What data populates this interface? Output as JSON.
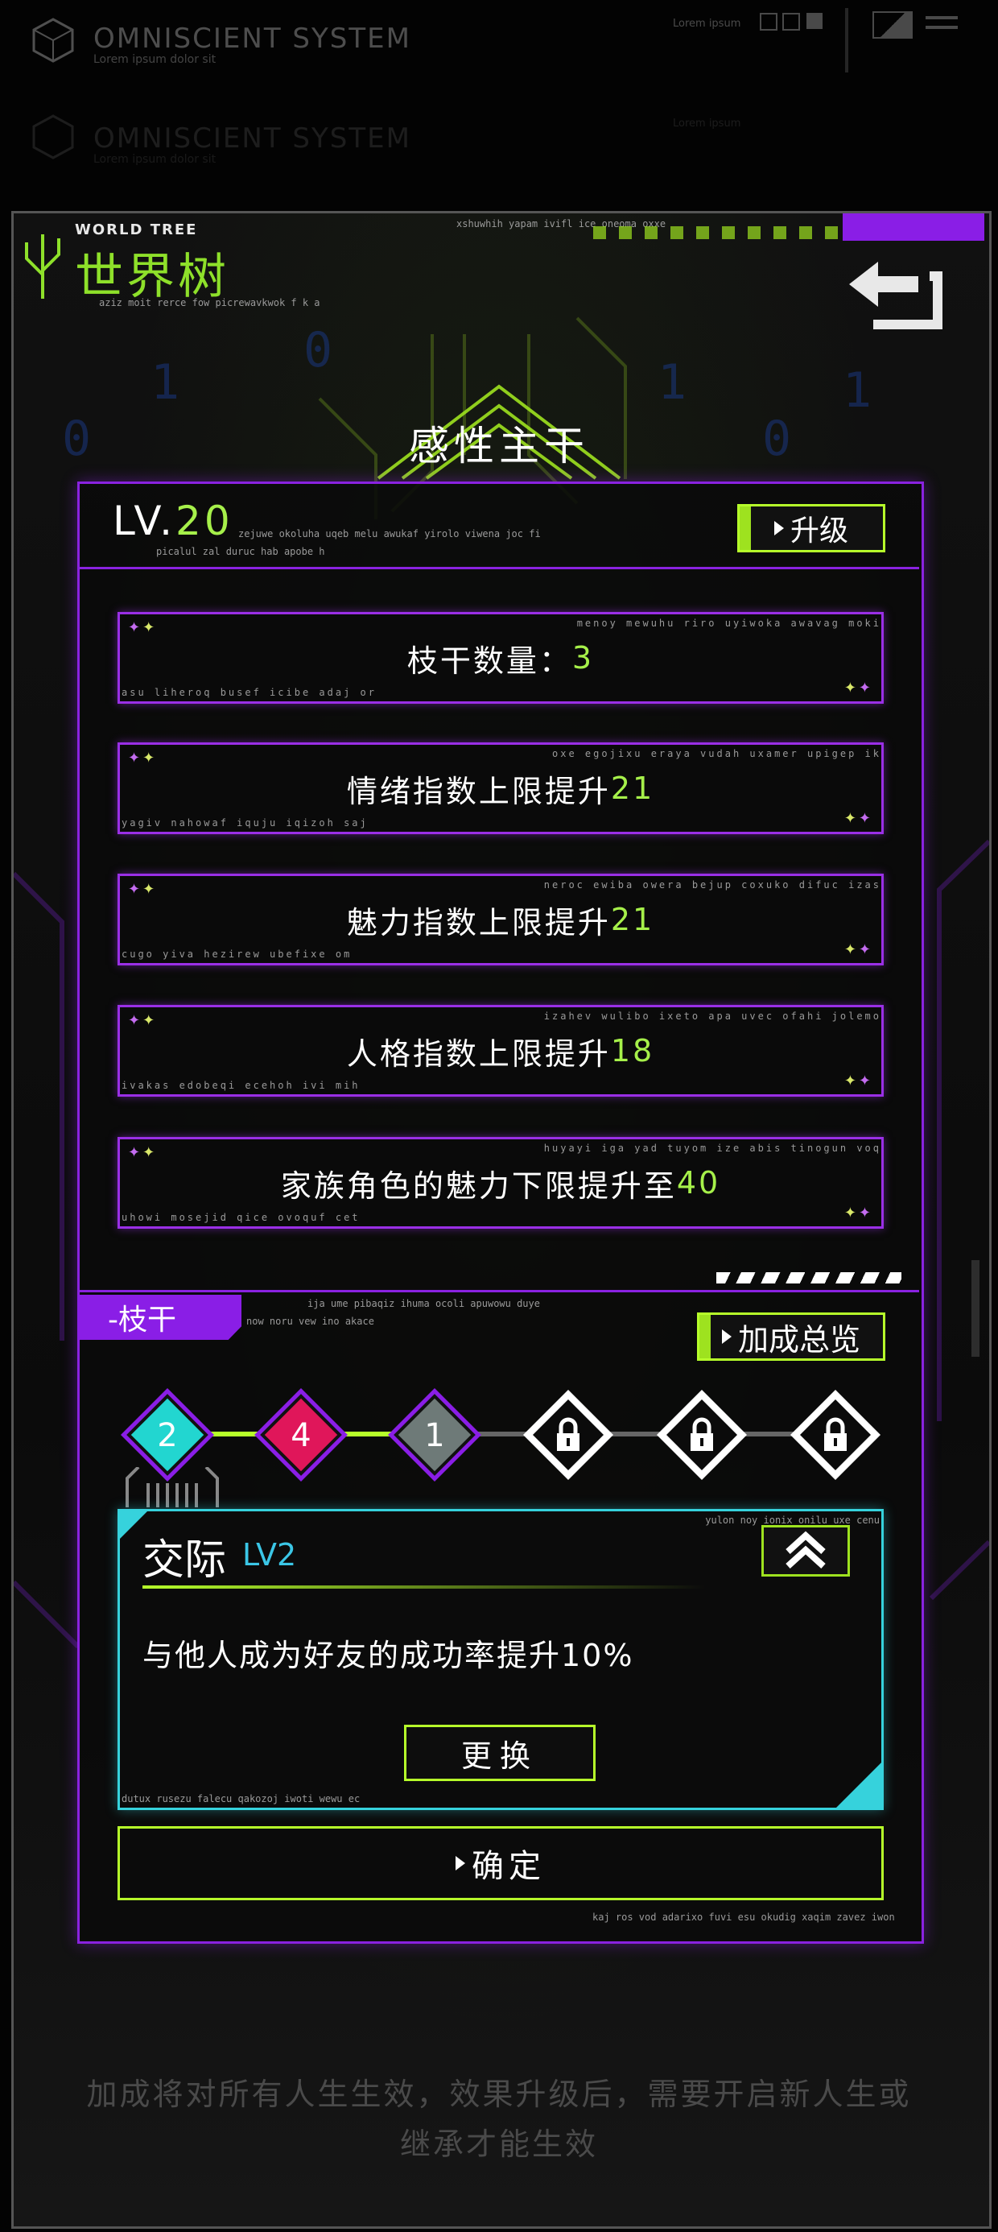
{
  "top_header": {
    "brand": "OMNISCIENT SYSTEM",
    "brand_sub": "Lorem ipsum dolor sit",
    "right_label": "Lorem ipsum",
    "brand_ghost": "OMNISCIENT SYSTEM",
    "brand_sub_ghost": "Lorem ipsum dolor sit",
    "right_label_ghost": "Lorem ipsum"
  },
  "header": {
    "en_title": "WORLD TREE",
    "cn_title": "世界树",
    "deco_top": "xshuwhih yapam ivifl ice oneoma oxxe",
    "deco_sub": "aziz moit rerce fow picrewavkwok f k a",
    "back_icon": "back-arrow-icon"
  },
  "main_title": "感性主干",
  "level": {
    "prefix": "LV.",
    "value": "20",
    "deco1": "zejuwe okoluha uqeb melu awukaf yirolo viwena joc fi",
    "deco2": "picalul zal duruc hab apobe h",
    "upgrade_label": "升级"
  },
  "stats": [
    {
      "label": "枝干数量：",
      "value": "3",
      "deco_tr": "menoy mewuhu riro uyiwoka awavag moki",
      "deco_bl": "asu liheroq busef icibe adaj or"
    },
    {
      "label": "情绪指数上限提升",
      "value": "21",
      "deco_tr": "oxe egojixu eraya vudah uxamer upigep ik",
      "deco_bl": "yagiv nahowaf iquju iqizoh saj"
    },
    {
      "label": "魅力指数上限提升",
      "value": "21",
      "deco_tr": "neroc ewiba owera bejup coxuko difuc izas",
      "deco_bl": "cugo yiva hezirew ubefixe om"
    },
    {
      "label": "人格指数上限提升",
      "value": "18",
      "deco_tr": "izahev wulibo ixeto apa uvec ofahi jolemo",
      "deco_bl": "ivakas edobeqi ecehoh ivi mih"
    },
    {
      "label": "家族角色的魅力下限提升至",
      "value": "40",
      "deco_tr": "huyayi iga yad tuyom ize abis tinogun voq",
      "deco_bl": "uhowi mosejid qice ovoquf cet"
    }
  ],
  "branch": {
    "tag": "-枝干",
    "deco1": "ija ume pibaqiz ihuma ocoli apuwowu duye",
    "deco2": "now noru vew ino akace",
    "bonus_label": "加成总览"
  },
  "nodes": [
    {
      "label": "2",
      "color": "#22d6d0",
      "state": "selected"
    },
    {
      "label": "4",
      "color": "#e0165a",
      "state": "unlocked"
    },
    {
      "label": "1",
      "color": "#6e7a78",
      "state": "unlocked"
    },
    {
      "label": "",
      "color": "#ffffff",
      "state": "locked",
      "icon": "lock-icon"
    },
    {
      "label": "",
      "color": "#ffffff",
      "state": "locked",
      "icon": "lock-icon"
    },
    {
      "label": "",
      "color": "#ffffff",
      "state": "locked",
      "icon": "lock-icon"
    }
  ],
  "skill": {
    "name": "交际",
    "level": "LV2",
    "description": "与他人成为好友的成功率提升10%",
    "deco_tr": "yulon noy ionix onilu uxe cenu",
    "deco_bl": "dutux rusezu falecu qakozoj iwoti wewu ec",
    "change_label": "更换",
    "collapse_icon": "double-chevron-up-icon"
  },
  "confirm_label": "确定",
  "panel_deco": "kaj ros vod adarixo fuvi esu okudig xaqim zavez iwon",
  "footer_note": "加成将对所有人生生效，效果升级后，需要开启新人生或继承才能生效",
  "colors": {
    "accent_green": "#a6f04a",
    "accent_purple": "#8a22e0",
    "accent_cyan": "#36d2dc",
    "node_pink": "#e0165a"
  }
}
